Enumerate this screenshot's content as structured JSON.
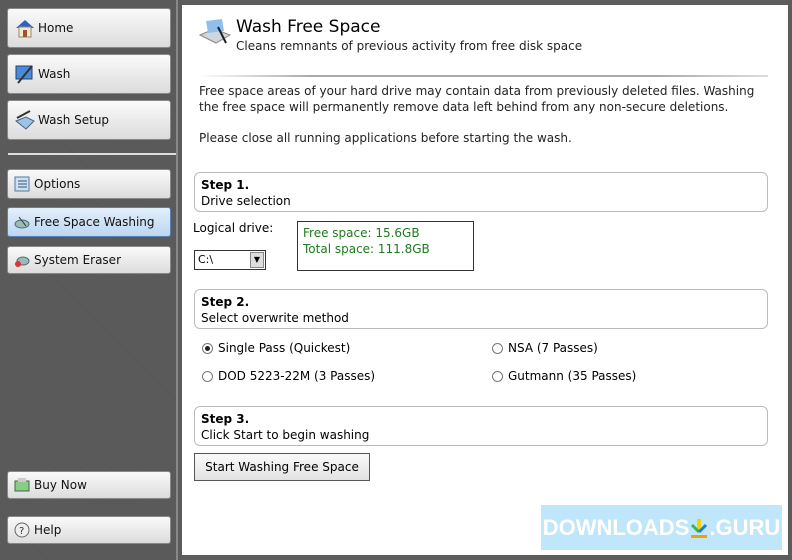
{
  "sidebar": {
    "items": [
      {
        "label": "Home",
        "icon": "home-icon"
      },
      {
        "label": "Wash",
        "icon": "wash-icon"
      },
      {
        "label": "Wash Setup",
        "icon": "wash-setup-icon"
      },
      {
        "label": "Options",
        "icon": "options-icon"
      },
      {
        "label": "Free Space Washing",
        "icon": "free-space-icon"
      },
      {
        "label": "System Eraser",
        "icon": "system-eraser-icon"
      },
      {
        "label": "Buy Now",
        "icon": "buy-now-icon"
      },
      {
        "label": "Help",
        "icon": "help-icon"
      }
    ],
    "selected": "Free Space Washing"
  },
  "header": {
    "title": "Wash Free Space",
    "subtitle": "Cleans remnants of previous activity from free disk space"
  },
  "intro": {
    "line1": "Free space areas of your hard drive may contain data from previously deleted files.  Washing",
    "line2": "the free space will permanently remove data left behind from any non-secure deletions.",
    "note": "Please close all running applications before starting the wash."
  },
  "step1": {
    "title": "Step 1.",
    "desc": "Drive selection",
    "drive_label": "Logical drive:",
    "drive_value": "C:\\",
    "free_space": "Free space: 15.6GB",
    "total_space": "Total space: 111.8GB"
  },
  "step2": {
    "title": "Step 2.",
    "desc": "Select overwrite method",
    "options": [
      "Single Pass (Quickest)",
      "DOD 5223-22M (3 Passes)",
      "NSA (7 Passes)",
      "Gutmann (35 Passes)"
    ],
    "selected": "Single Pass (Quickest)"
  },
  "step3": {
    "title": "Step 3.",
    "desc": "Click Start to begin washing",
    "button": "Start Washing Free Space"
  },
  "watermark": {
    "text": "DOWNLOADS",
    "suffix": ".GURU"
  },
  "colors": {
    "accent_green": "#1f7a1f",
    "selected_nav": "#bcd6f2"
  }
}
